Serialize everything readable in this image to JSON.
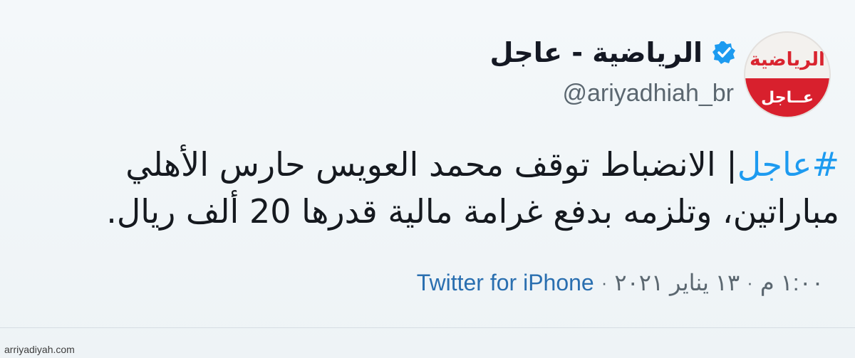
{
  "account": {
    "avatar_top_text": "الرياضية",
    "avatar_bottom_text": "عــاجل",
    "display_name": "الرياضية - عاجل",
    "handle": "@ariyadhiah_br",
    "verified_icon": "verified-badge-icon"
  },
  "tweet": {
    "hashtag": "#عاجل",
    "body": "| الانضباط توقف محمد العويس حارس الأهلي مباراتين، وتلزمه بدفع غرامة مالية قدرها 20 ألف ريال."
  },
  "meta": {
    "time": "١:٠٠ م",
    "date": "١٣ يناير ٢٠٢١",
    "source": "Twitter for iPhone",
    "separator": "·"
  },
  "footer": {
    "watermark": "arriyadiyah.com"
  },
  "colors": {
    "hashtag": "#1d9bf0",
    "verified": "#1d9bf0",
    "brand_red": "#d8202d"
  }
}
